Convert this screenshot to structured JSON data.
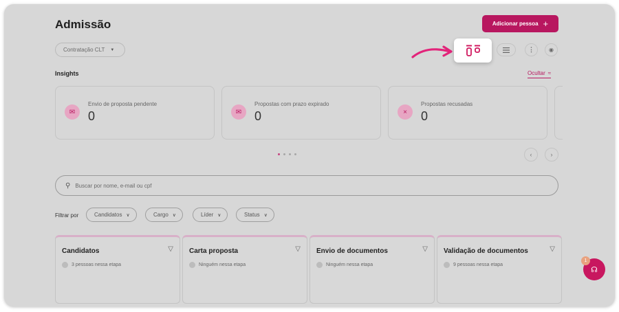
{
  "header": {
    "title": "Admissão",
    "add_label": "Adicionar pessoa",
    "add_icon": "+"
  },
  "toolbar": {
    "contract_type": "Contratação CLT",
    "more_glyph": "⋮",
    "circle_glyph": "◉"
  },
  "insights": {
    "title": "Insights",
    "hide_label": "Ocultar",
    "hide_glyph": "≈",
    "cards": [
      {
        "label": "Envio de proposta pendente",
        "value": "0",
        "icon": "mail-icon",
        "glyph": "✉"
      },
      {
        "label": "Propostas com prazo expirado",
        "value": "0",
        "icon": "mail-x-icon",
        "glyph": "✉"
      },
      {
        "label": "Propostas recusadas",
        "value": "0",
        "icon": "close-icon",
        "glyph": "×"
      }
    ],
    "pagination": {
      "total": 4,
      "active": 1
    },
    "prev_glyph": "‹",
    "next_glyph": "›"
  },
  "search": {
    "placeholder": "Buscar por nome, e-mail ou cpf",
    "icon_glyph": "⚲"
  },
  "filters": {
    "label": "Filtrar por",
    "chips": [
      "Candidatos",
      "Cargo",
      "Líder",
      "Status"
    ],
    "chevron_glyph": "∨"
  },
  "columns": [
    {
      "title": "Candidatos",
      "count": "3 pessoas nessa etapa"
    },
    {
      "title": "Carta proposta",
      "count": "Ninguém nessa etapa"
    },
    {
      "title": "Envio de documentos",
      "count": "Ninguém nessa etapa"
    },
    {
      "title": "Validação de documentos",
      "count": "9 pessoas nessa etapa"
    }
  ],
  "column_filter_glyph": "▽",
  "help": {
    "badge": "1",
    "glyph": "☊"
  },
  "colors": {
    "accent": "#b8175f",
    "background": "#d7d7d7"
  }
}
